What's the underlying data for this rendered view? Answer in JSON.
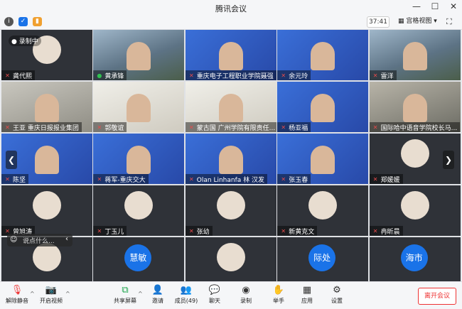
{
  "app": {
    "title": "腾讯会议"
  },
  "toolbar": {
    "timer": "37:41",
    "view_label": "宫格视图"
  },
  "recording": {
    "label": "录制中"
  },
  "tiles": [
    {
      "name": "龚代熙",
      "mic": "muted",
      "style": "dark"
    },
    {
      "name": "黄承锋",
      "mic": "on",
      "style": "photo"
    },
    {
      "name": "重庆电子工程职业学院聂强",
      "mic": "muted",
      "style": "blue"
    },
    {
      "name": "余元玲",
      "mic": "muted",
      "style": "blue"
    },
    {
      "name": "雷洋",
      "mic": "muted",
      "style": "photo"
    },
    {
      "name": "王亚 重庆日报报业集团",
      "mic": "muted",
      "style": "doc"
    },
    {
      "name": "郭敬谊",
      "mic": "muted",
      "style": "wall"
    },
    {
      "name": "蒙古国 广州学院有限责任...",
      "mic": "muted",
      "style": "wall"
    },
    {
      "name": "杨亚福",
      "mic": "muted",
      "style": "blue"
    },
    {
      "name": "国际哈中语音学院校长马...",
      "mic": "muted",
      "style": "room"
    },
    {
      "name": "陈坚",
      "mic": "muted",
      "style": "blue"
    },
    {
      "name": "蒋军-重庆交大",
      "mic": "muted",
      "style": "blue"
    },
    {
      "name": "Olan Linhanfa 林 汉发",
      "mic": "muted",
      "style": "blue"
    },
    {
      "name": "张玉春",
      "mic": "muted",
      "style": "blue"
    },
    {
      "name": "郑媛媛",
      "mic": "muted",
      "style": "dark"
    },
    {
      "name": "曾旭涛",
      "mic": "muted",
      "style": "dark"
    },
    {
      "name": "丁玉儿",
      "mic": "muted",
      "style": "dark"
    },
    {
      "name": "张幼",
      "mic": "muted",
      "style": "dark"
    },
    {
      "name": "新黄克文",
      "mic": "muted",
      "style": "dark"
    },
    {
      "name": "冉昕晨",
      "mic": "muted",
      "style": "dark"
    },
    {
      "name": "",
      "mic": "muted",
      "style": "dark"
    },
    {
      "name": "",
      "mic": "muted",
      "style": "dark",
      "initials": "慧敏"
    },
    {
      "name": "",
      "mic": "muted",
      "style": "dark"
    },
    {
      "name": "",
      "mic": "muted",
      "style": "dark",
      "initials": "际处"
    },
    {
      "name": "",
      "mic": "muted",
      "style": "dark",
      "initials": "海市"
    }
  ],
  "chat": {
    "placeholder": "说点什么..."
  },
  "bottom": {
    "unmute": "解除静音",
    "video": "开启视频",
    "share": "共享屏幕",
    "invite": "邀请",
    "members": "成员(49)",
    "chat": "聊天",
    "record": "录制",
    "raise": "举手",
    "apps": "应用",
    "settings": "设置",
    "leave": "离开会议"
  }
}
